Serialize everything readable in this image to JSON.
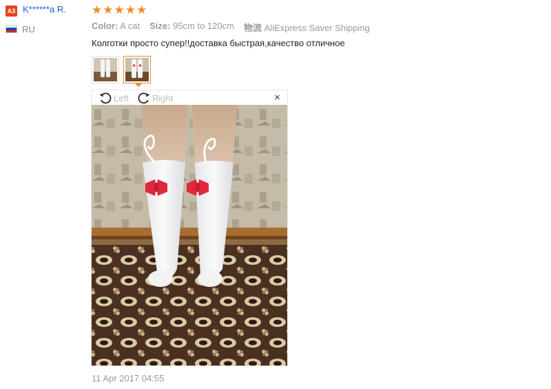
{
  "reviewer": {
    "badge": "A3",
    "name": "K******a R.",
    "country": "RU"
  },
  "rating": {
    "stars": 5,
    "max": 5
  },
  "attributes": {
    "color_label": "Color:",
    "color_value": "A cat",
    "size_label": "Size:",
    "size_value": "95cm to 120cm",
    "shipping_label": "物流",
    "shipping_value": "AliExpress Saver Shipping"
  },
  "review": {
    "text": "Колготки просто супер!!доставка быстрая,качество отличное",
    "timestamp": "11 Apr 2017 04:55"
  },
  "viewer": {
    "rotate_left_label": "Left",
    "rotate_right_label": "Right",
    "close_glyph": "×",
    "selected_thumbnail": 2
  },
  "colors": {
    "star": "#f58a1f",
    "name_link": "#1d5ed7",
    "badge": "#e8401f",
    "thumb_active_border": "#f08a24"
  }
}
